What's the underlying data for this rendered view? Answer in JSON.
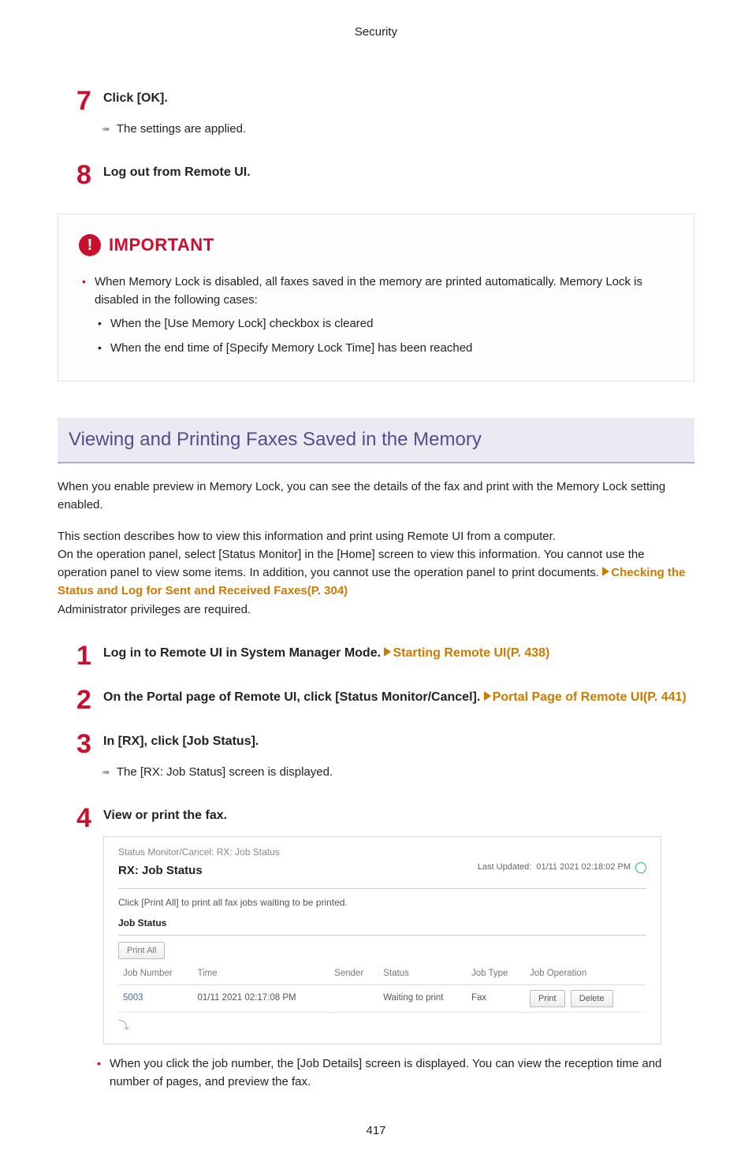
{
  "page_header": "Security",
  "steps_block1": [
    {
      "num": "7",
      "title": "Click [OK].",
      "result": "The settings are applied."
    },
    {
      "num": "8",
      "title": "Log out from Remote UI."
    }
  ],
  "important": {
    "label": "IMPORTANT",
    "icon_glyph": "!",
    "bullets": [
      {
        "text": "When Memory Lock is disabled, all faxes saved in the memory are printed automatically. Memory Lock is disabled in the following cases:",
        "subs": [
          "When the [Use Memory Lock] checkbox is cleared",
          "When the end time of [Specify Memory Lock Time] has been reached"
        ]
      }
    ]
  },
  "section_heading": "Viewing and Printing Faxes Saved in the Memory",
  "intro1": "When you enable preview in Memory Lock, you can see the details of the fax and print with the Memory Lock setting enabled.",
  "intro2_pre": "This section describes how to view this information and print using Remote UI from a computer.\nOn the operation panel, select [Status Monitor] in the [Home] screen to view this information. You cannot use the operation panel to view some items. In addition, you cannot use the operation panel to print documents. ",
  "intro2_link": "Checking the Status and Log for Sent and Received Faxes(P. 304)",
  "intro2_post": "Administrator privileges are required.",
  "steps_block2": [
    {
      "num": "1",
      "title_pre": "Log in to Remote UI in System Manager Mode. ",
      "link": "Starting Remote UI(P. 438)"
    },
    {
      "num": "2",
      "title_pre": "On the Portal page of Remote UI, click [Status Monitor/Cancel]. ",
      "link": "Portal Page of Remote UI(P. 441)"
    },
    {
      "num": "3",
      "title_pre": "In [RX], click [Job Status].",
      "result": "The [RX: Job Status] screen is displayed."
    },
    {
      "num": "4",
      "title_pre": "View or print the fax."
    }
  ],
  "screenshot": {
    "breadcrumb": "Status Monitor/Cancel: RX: Job Status",
    "title": "RX: Job Status",
    "last_updated_label": "Last Updated:",
    "last_updated_value": "01/11 2021 02:18:02 PM",
    "instruction": "Click [Print All] to print all fax jobs waiting to be printed.",
    "sub_heading": "Job Status",
    "print_all_label": "Print All",
    "columns": [
      "Job Number",
      "Time",
      "Sender",
      "Status",
      "Job Type",
      "Job Operation"
    ],
    "row": {
      "job_number": "5003",
      "time": "01/11 2021 02:17:08 PM",
      "sender": "",
      "status": "Waiting to print",
      "job_type": "Fax",
      "op_print": "Print",
      "op_delete": "Delete"
    },
    "underbar": "⤵"
  },
  "notes": [
    "When you click the job number, the [Job Details] screen is displayed. You can view the reception time and number of pages, and preview the fax."
  ],
  "page_number": "417"
}
